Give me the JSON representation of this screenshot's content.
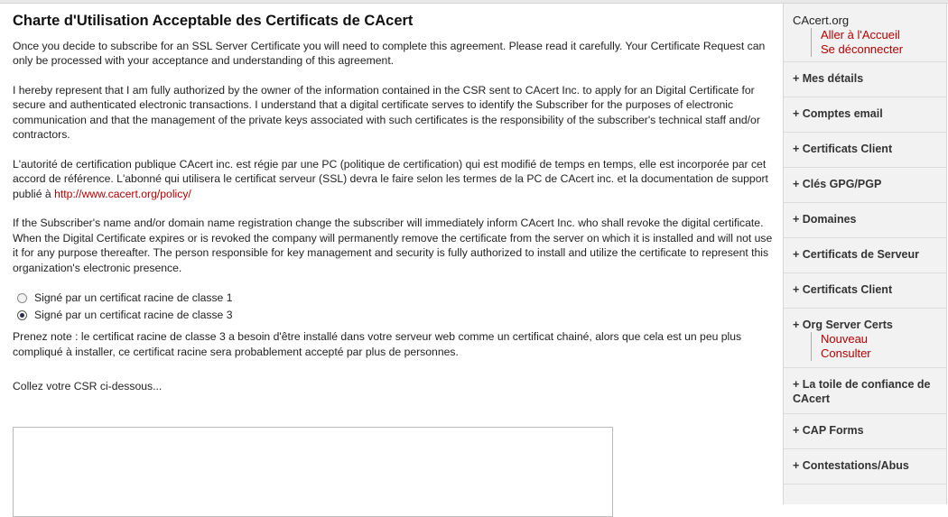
{
  "title": "Charte d'Utilisation Acceptable des Certificats de CAcert",
  "paragraphs": {
    "intro": "Once you decide to subscribe for an SSL Server Certificate you will need to complete this agreement. Please read it carefully. Your Certificate Request can only be processed with your acceptance and understanding of this agreement.",
    "represent": "I hereby represent that I am fully authorized by the owner of the information contained in the CSR sent to CAcert Inc. to apply for an Digital Certificate for secure and authenticated electronic transactions. I understand that a digital certificate serves to identify the Subscriber for the purposes of electronic communication and that the management of the private keys associated with such certificates is the responsibility of the subscriber's technical staff and/or contractors.",
    "authority_prefix": "L'autorité de certification publique CAcert inc. est régie par une PC (politique de certification) qui est modifié de temps en temps, elle est incorporée par cet accord de référence. L'abonné qui utilisera le certificat serveur (SSL) devra le faire selon les termes de la PC de CAcert inc. et la documentation de support publié à ",
    "authority_link": "http://www.cacert.org/policy/",
    "change": "If the Subscriber's name and/or domain name registration change the subscriber will immediately inform CAcert Inc. who shall revoke the digital certificate. When the Digital Certificate expires or is revoked the company will permanently remove the certificate from the server on which it is installed and will not use it for any purpose thereafter. The person responsible for key management and security is fully authorized to install and utilize the certificate to represent this organization's electronic presence.",
    "note": "Prenez note : le certificat racine de classe 3 a besoin d'être installé dans votre serveur web comme un certificat chainé, alors que cela est un peu plus compliqué à installer, ce certificat racine sera probablement accepté par plus de personnes.",
    "paste": "Collez votre CSR ci-dessous..."
  },
  "radios": [
    {
      "label": "Signé par un certificat racine de classe 1",
      "checked": false
    },
    {
      "label": "Signé par un certificat racine de classe 3",
      "checked": true
    }
  ],
  "csr_value": "",
  "sidebar": {
    "site": "CAcert.org",
    "site_links": [
      "Aller à l'Accueil",
      "Se déconnecter"
    ],
    "items": [
      "+ Mes détails",
      "+ Comptes email",
      "+ Certificats Client",
      "+ Clés GPG/PGP",
      "+ Domaines",
      "+ Certificats de Serveur",
      "+ Certificats Client",
      "+ Org Server Certs",
      "+ La toile de confiance de CAcert",
      "+ CAP Forms",
      "+ Contestations/Abus"
    ],
    "org_links": [
      "Nouveau",
      "Consulter"
    ]
  }
}
